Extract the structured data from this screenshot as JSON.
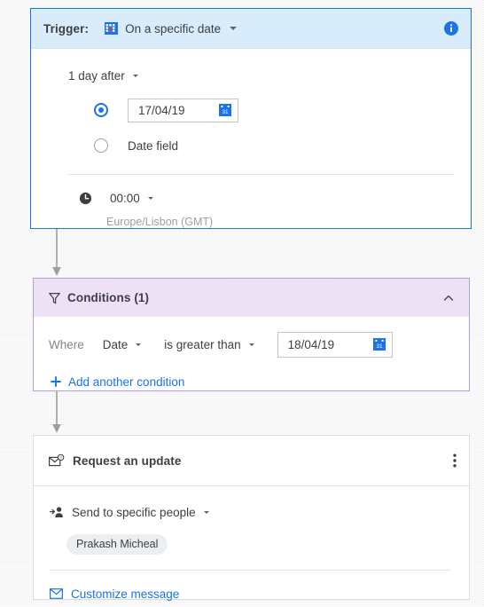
{
  "trigger": {
    "label": "Trigger:",
    "icon": "grid-icon",
    "value": "On a specific date",
    "info_icon": "info-icon",
    "offset": "1 day after",
    "date_option_value": "17/04/19",
    "date_field_label": "Date field",
    "time_icon": "clock-icon",
    "time": "00:00",
    "timezone": "Europe/Lisbon (GMT)"
  },
  "conditions": {
    "icon": "filter-icon",
    "title": "Conditions (1)",
    "collapse_icon": "chevron-up-icon",
    "where_label": "Where",
    "field": "Date",
    "operator": "is greater than",
    "value": "18/04/19",
    "add_label": "Add another condition",
    "add_icon": "plus-icon"
  },
  "action": {
    "icon": "mail-request-icon",
    "title": "Request an update",
    "menu_icon": "kebab-menu-icon",
    "send_icon": "person-add-icon",
    "send_mode": "Send to specific people",
    "recipients": [
      "Prakash Micheal"
    ],
    "customize_icon": "mail-icon",
    "customize_label": "Customize message"
  },
  "colors": {
    "trigger_border": "#1a73e8",
    "trigger_header_bg": "#d9ecfb",
    "conditions_border": "#b39ddb",
    "conditions_header_bg": "#ede2f5",
    "action_border": "#dadce0",
    "link": "#1a73e8",
    "text": "#3c4043",
    "muted": "#80868b",
    "connector": "#9e9e9e",
    "chip_bg": "#eceff1"
  }
}
